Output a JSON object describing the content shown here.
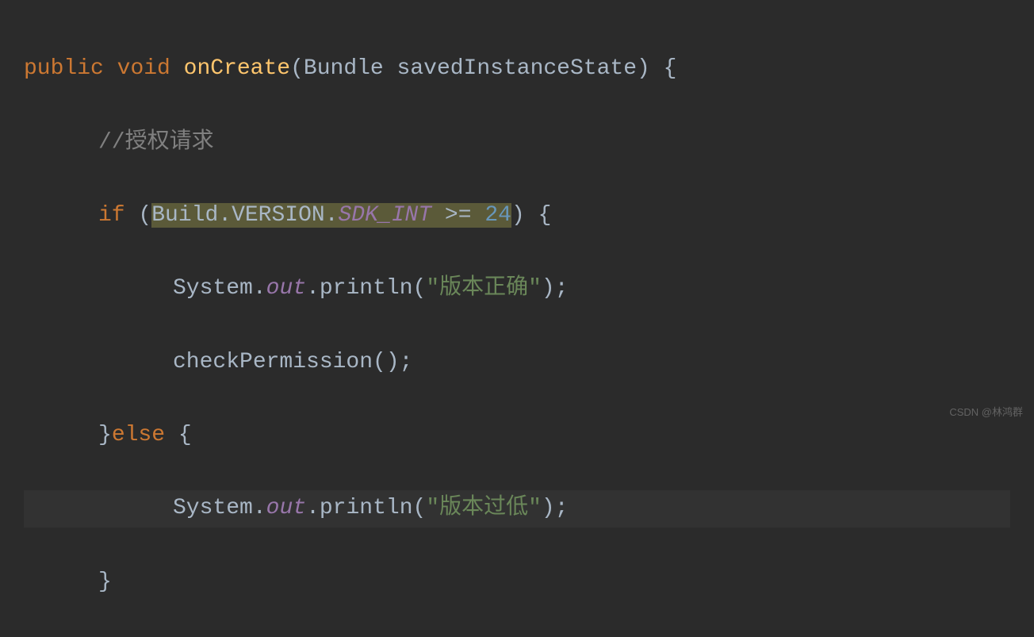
{
  "code": {
    "line1": {
      "kw_public": "public",
      "kw_void": "void",
      "method": "onCreate",
      "lparen": "(",
      "param_type": "Bundle",
      "param_name": "savedInstanceState",
      "rparen": ")",
      "lbrace": "{"
    },
    "line2": {
      "comment": "//授权请求"
    },
    "line3": {
      "kw_if": "if",
      "lparen": "(",
      "build": "Build",
      "dot1": ".",
      "version": "VERSION",
      "dot2": ".",
      "sdk_int": "SDK_INT",
      "gte": " >= ",
      "num": "24",
      "rparen": ")",
      "lbrace": "{"
    },
    "line4": {
      "system": "System",
      "dot1": ".",
      "out": "out",
      "dot2": ".",
      "println": "println",
      "lparen": "(",
      "str": "\"版本正确\"",
      "rparen": ")",
      "semi": ";"
    },
    "line5": {
      "call": "checkPermission",
      "lparen": "(",
      "rparen": ")",
      "semi": ";"
    },
    "line6": {
      "rbrace": "}",
      "kw_else": "else",
      "lbrace": "{"
    },
    "line7": {
      "system": "System",
      "dot1": ".",
      "out": "out",
      "dot2": ".",
      "println": "println",
      "lparen": "(",
      "str": "\"版本过低\"",
      "rparen": ")",
      "semi": ";"
    },
    "line8": {
      "rbrace": "}"
    }
  },
  "watermark": "CSDN @林鸿群"
}
